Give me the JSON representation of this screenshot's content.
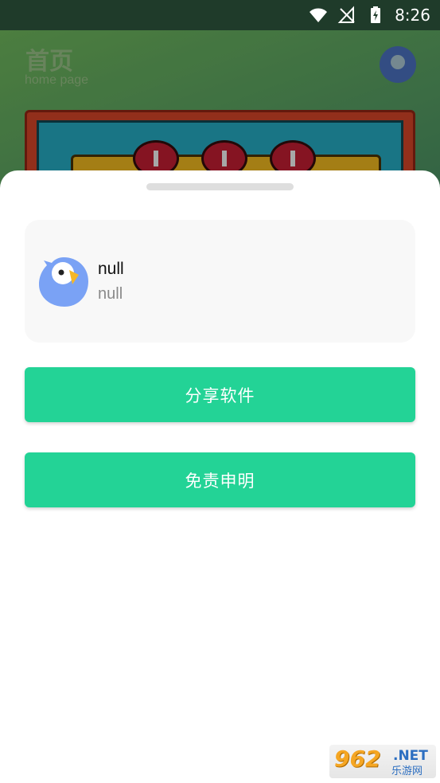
{
  "status_bar": {
    "time": "8:26",
    "icons": [
      "wifi-icon",
      "no-signal-icon",
      "battery-charging-icon"
    ]
  },
  "background": {
    "title": "首页",
    "subtitle": "home page",
    "avatar_icon": "parrot-avatar-icon"
  },
  "sheet": {
    "profile": {
      "name": "null",
      "subtitle": "null",
      "avatar_icon": "parrot-avatar-icon"
    },
    "buttons": {
      "share": "分享软件",
      "disclaimer": "免责申明"
    }
  },
  "watermark": {
    "number": "962",
    "domain": ".NET",
    "cn": "乐游网"
  },
  "colors": {
    "accent": "#23d396",
    "card_bg": "#f8f8f8",
    "sheet_bg": "#ffffff"
  }
}
